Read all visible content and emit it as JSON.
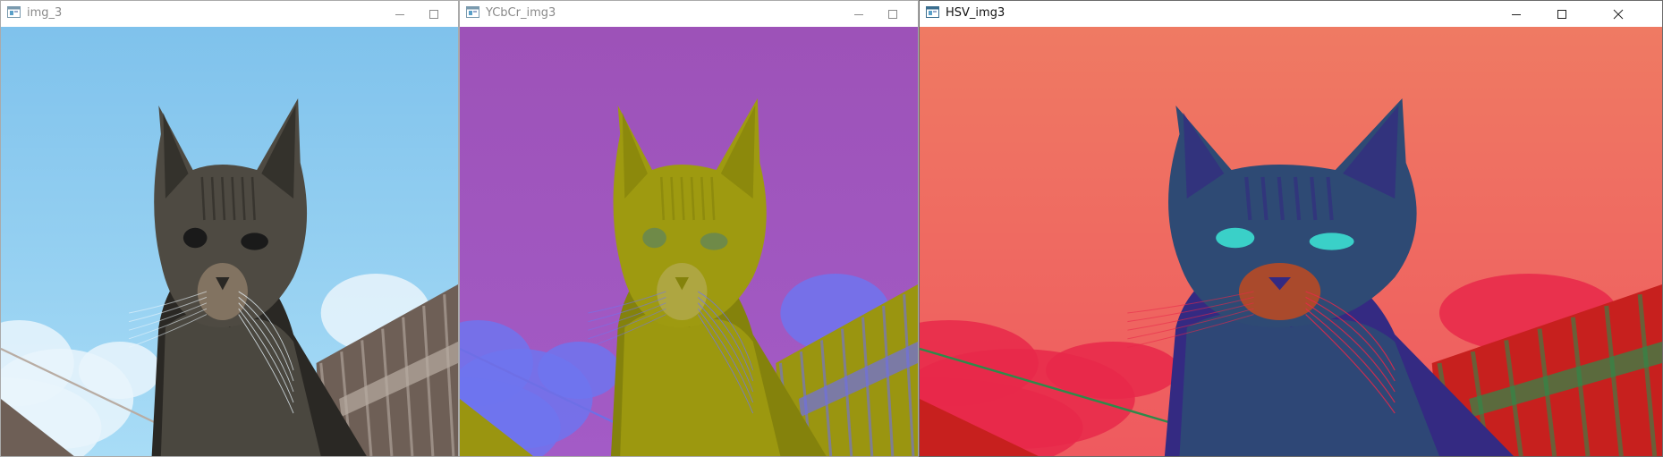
{
  "windows": [
    {
      "title": "img_3",
      "state": "inactive",
      "image": "cat-photo-original",
      "palette": {
        "sky_top": "#7fc2ec",
        "sky_bottom": "#a8dcf6",
        "cloud": "#e9f5fc",
        "cat": "#4e4a42",
        "cat_dark": "#2a2824",
        "muzzle": "#8c7a66",
        "roof": "#6e5f56",
        "roof_light": "#b8aca3",
        "eye": "#1a1a1a"
      }
    },
    {
      "title": "YCbCr_img3",
      "state": "inactive",
      "image": "cat-photo-ycbcr",
      "palette": {
        "sky_top": "#9d52b8",
        "sky_bottom": "#a35bc6",
        "cloud": "#6f74ee",
        "cat": "#9e9a10",
        "cat_dark": "#84820c",
        "muzzle": "#b0a84a",
        "roof": "#9a9510",
        "roof_light": "#6e6fe6",
        "eye": "#6f8a48"
      }
    },
    {
      "title": "HSV_img3",
      "state": "active",
      "image": "cat-photo-hsv",
      "palette": {
        "sky_top": "#ef7a63",
        "sky_bottom": "#ef5a5f",
        "cloud": "#e8284a",
        "cat": "#2e4a74",
        "cat_dark": "#342a82",
        "muzzle": "#c04a20",
        "roof": "#c7201e",
        "roof_light": "#2e8a4a",
        "eye": "#3ad0c8"
      }
    }
  ],
  "controls": {
    "minimize": "minimize-icon",
    "maximize": "maximize-icon",
    "close": "close-icon"
  }
}
